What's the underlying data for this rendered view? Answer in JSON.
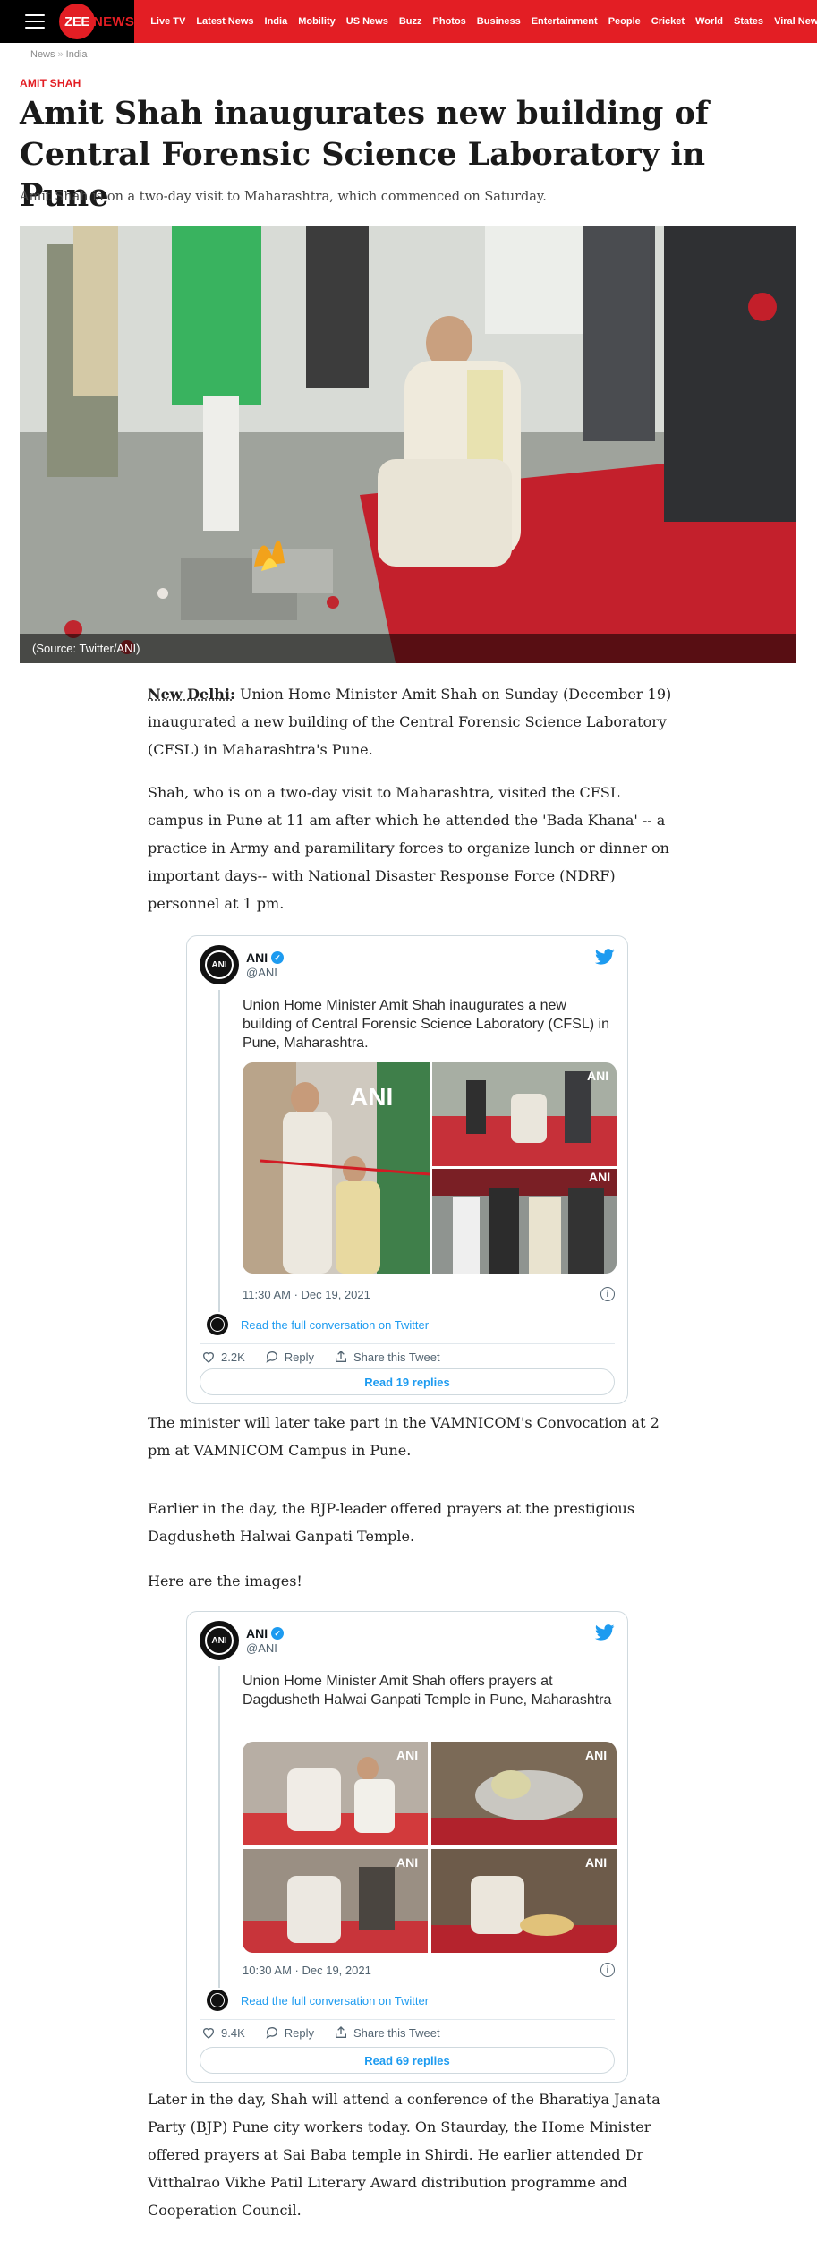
{
  "header": {
    "logo_zee": "ZEE",
    "logo_news": "NEWS",
    "nav": [
      "Live TV",
      "Latest News",
      "India",
      "Mobility",
      "US News",
      "Buzz",
      "Photos",
      "Business",
      "Entertainment",
      "People",
      "Cricket",
      "World",
      "States",
      "Viral News"
    ],
    "more": "..."
  },
  "breadcrumb": [
    "News",
    "India"
  ],
  "breadcrumb_sep": "»",
  "article": {
    "tag": "AMIT SHAH",
    "headline": "Amit Shah inaugurates new building of Central Forensic Science Laboratory in Pune",
    "subhead": "Amit Shah is on a two-day visit to Maharashtra, which commenced on Saturday.",
    "hero_caption": "(Source: Twitter/ANI)",
    "p1_dateline": "New Delhi:",
    "p1_body": " Union Home Minister Amit Shah on Sunday (December 19) inaugurated a new building of the Central Forensic Science Laboratory (CFSL) in Maharashtra's Pune.",
    "p2": "Shah, who is on a two-day visit to Maharashtra, visited the CFSL campus in Pune at 11 am after which he attended the 'Bada Khana' -- a practice in Army and paramilitary forces to organize lunch or dinner on important days-- with National Disaster Response Force (NDRF) personnel at 1 pm.",
    "p3": "The minister will later take part in the VAMNICOM's Convocation at 2 pm at VAMNICOM Campus in Pune.",
    "p4": "Earlier in the day, the BJP-leader offered prayers at the prestigious Dagdusheth Halwai Ganpati Temple.",
    "p5": "Here are the images!",
    "p6": "Later in the day, Shah will attend a conference of the Bharatiya Janata Party (BJP) Pune city workers today. On Staurday, the Home Minister offered prayers at Sai Baba temple in Shirdi. He earlier attended Dr Vitthalrao Vikhe Patil Literary Award distribution programme and Cooperation Council."
  },
  "tweets": [
    {
      "name": "ANI",
      "handle": "@ANI",
      "text": "Union Home Minister Amit Shah inaugurates a new building of Central Forensic Science Laboratory (CFSL) in Pune, Maharashtra.",
      "timestamp": "11:30 AM · Dec 19, 2021",
      "conversation": "Read the full conversation on Twitter",
      "likes": "2.2K",
      "reply_label": "Reply",
      "share_label": "Share this Tweet",
      "replies_button": "Read 19 replies",
      "watermark": "ANI",
      "avatar_text": "ANI"
    },
    {
      "name": "ANI",
      "handle": "@ANI",
      "text": "Union Home Minister Amit Shah offers prayers at Dagdusheth Halwai Ganpati Temple in Pune, Maharashtra",
      "timestamp": "10:30 AM · Dec 19, 2021",
      "conversation": "Read the full conversation on Twitter",
      "likes": "9.4K",
      "reply_label": "Reply",
      "share_label": "Share this Tweet",
      "replies_button": "Read 69 replies",
      "watermark": "ANI",
      "avatar_text": "ANI"
    }
  ],
  "colors": {
    "brand_red": "#e31e24",
    "twitter_blue": "#1d9bf0",
    "text_dark": "#1a1a1a"
  },
  "icons": [
    "hamburger-icon",
    "twitter-bird-icon",
    "verified-badge-icon",
    "heart-icon",
    "reply-icon",
    "share-icon",
    "info-icon"
  ]
}
